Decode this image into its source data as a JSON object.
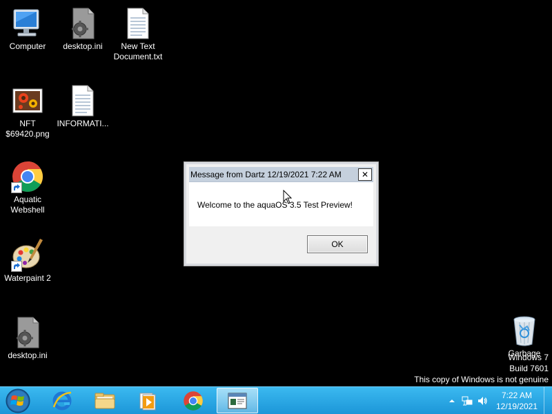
{
  "desktop": {
    "icons": [
      {
        "label": "Computer"
      },
      {
        "label": "desktop.ini"
      },
      {
        "label": "New Text Document.txt"
      },
      {
        "label": "NFT $69420.png"
      },
      {
        "label": "INFORMATI..."
      },
      {
        "label": "Aquatic Webshell"
      },
      {
        "label": "Waterpaint 2"
      },
      {
        "label": "desktop.ini"
      },
      {
        "label": "Garbage"
      }
    ]
  },
  "dialog": {
    "title": "Message from Dartz 12/19/2021 7:22 AM",
    "message": "Welcome to the aquaOS 3.5 Test Preview!",
    "ok_label": "OK",
    "close_symbol": "✕"
  },
  "watermark": {
    "line1": "Windows 7",
    "line2": "Build 7601",
    "line3": "This copy of Windows is not genuine"
  },
  "taskbar": {
    "pinned": [
      {
        "icon": "internet-explorer-icon"
      },
      {
        "icon": "file-explorer-icon"
      },
      {
        "icon": "media-player-icon"
      },
      {
        "icon": "chrome-icon"
      },
      {
        "icon": "message-window-icon"
      }
    ],
    "tray": {
      "time": "7:22 AM",
      "date": "12/19/2021"
    }
  },
  "colors": {
    "desktop_bg": "#000000",
    "taskbar": "#1c96d8",
    "dialog_title_bg": "#c5d0dd"
  }
}
